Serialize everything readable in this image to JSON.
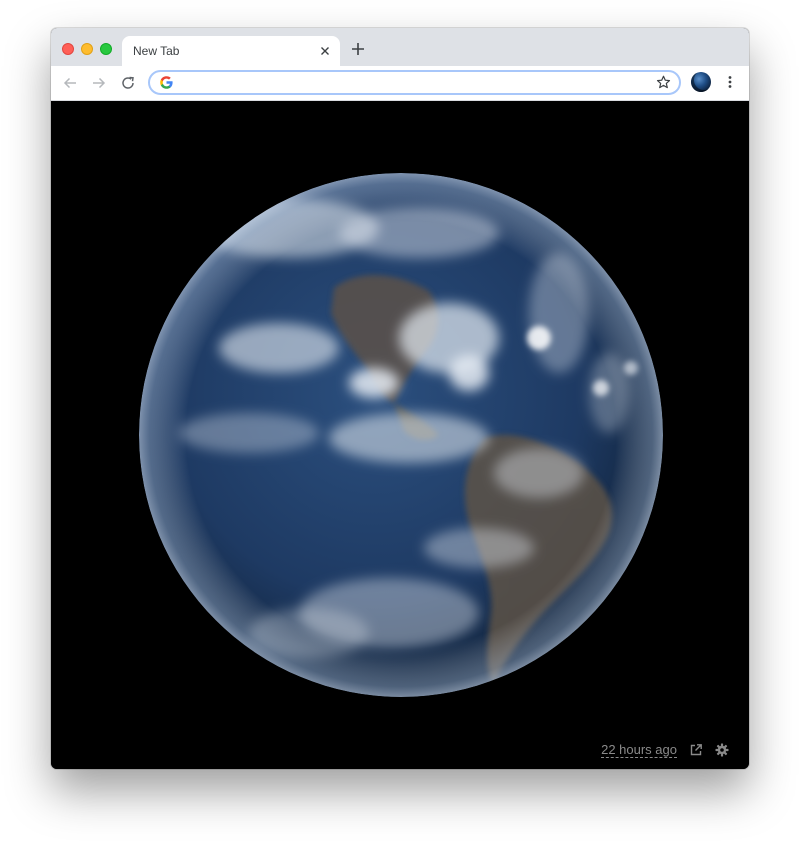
{
  "browser": {
    "tab": {
      "title": "New Tab"
    },
    "omnibox": {
      "value": "",
      "placeholder": ""
    },
    "icons": [
      "close-icon",
      "plus-icon",
      "back-arrow-icon",
      "forward-arrow-icon",
      "reload-icon",
      "google-g-icon",
      "star-icon",
      "profile-avatar",
      "more-vert-icon"
    ]
  },
  "page": {
    "image_subject": "earth",
    "footer": {
      "time_label": "22 hours ago",
      "icons": [
        "external-link-icon",
        "gear-icon"
      ]
    }
  },
  "colors": {
    "tabstrip": "#dee1e6",
    "omnibox_border": "#a8c7fa",
    "ocean": "#1e3a63",
    "footer_text": "#8a8a8a"
  }
}
